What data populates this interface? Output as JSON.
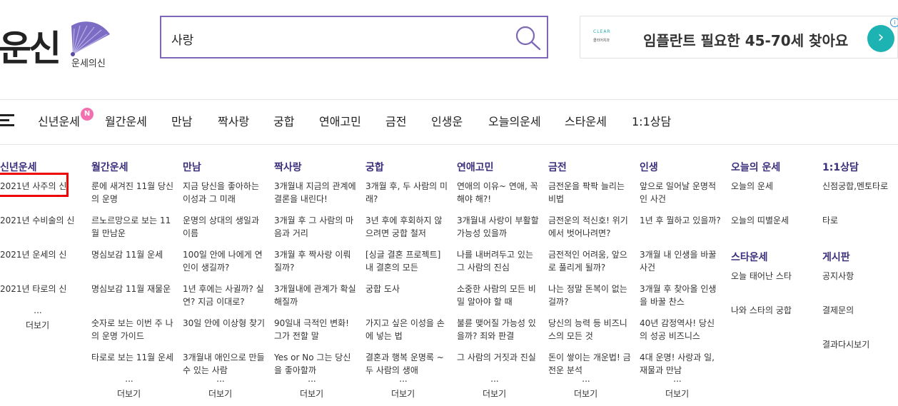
{
  "logo": {
    "main": "운신",
    "sub": "운세의신"
  },
  "search": {
    "value": "사랑"
  },
  "ad": {
    "logo_top": "CLEAR",
    "logo_bottom": "클리어치과",
    "text": "임플란트 필요한 45-70세 찾아요",
    "arrow": "›",
    "info": "i"
  },
  "nav": {
    "new_badge": "N",
    "items": [
      "신년운세",
      "월간운세",
      "만남",
      "짝사랑",
      "궁합",
      "연애고민",
      "금전",
      "인생운",
      "오늘의운세",
      "스타운세",
      "1:1상담"
    ]
  },
  "columns": [
    {
      "title": "신년운세",
      "links": [
        "2021년 사주의 신",
        "2021년 수비술의 신",
        "2021년 운세의 신",
        "2021년 타로의 신"
      ],
      "more_dots": "...",
      "more": "더보기"
    },
    {
      "title": "월간운세",
      "links": [
        "룬에 새겨진 11월 당신의 운명",
        "르노르망으로 보는 11월 만남운",
        "명심보감 11월 운세",
        "명심보감 11월 재물운",
        "숫자로 보는 이번 주 나의 운명 가이드",
        "타로로 보는 11월 운세"
      ],
      "more_dots": "...",
      "more": "더보기"
    },
    {
      "title": "만남",
      "links": [
        "지금 당신을 좋아하는 이성과 그 미래",
        "운명의 상대의 생일과 이름",
        "100일 안에 나에게 연인이 생길까?",
        "1년 후에는 사귈까? 실연? 지금 이대로?",
        "30일 안에 이상형 찾기",
        "3개월내 애인으로 만들 수 있는 사람"
      ],
      "more_dots": "...",
      "more": "더보기"
    },
    {
      "title": "짝사랑",
      "links": [
        "3개월내 지금의 관계에 결론을 내린다!",
        "3개월 후 그 사람의 마음과 거리",
        "3개월 후 짝사랑 이뤄질까?",
        "3개월내에 관계가 확실해질까",
        "90일내 극적인 변화! 그가 전할 말",
        "Yes or No 그는 당신을 좋아할까"
      ],
      "more_dots": "...",
      "more": "더보기"
    },
    {
      "title": "궁합",
      "links": [
        "3개월 후, 두 사람의 미래?",
        "3년 후에 후회하지 않으려면 궁합 철저",
        "[싱글 결혼 프로젝트] 내 결혼의 모든",
        "궁합 도사",
        "가지고 싶은 이성을 손에 넣는 법",
        "결혼과 행복 운명록 ~ 두 사람의 생애"
      ],
      "more_dots": "...",
      "more": "더보기"
    },
    {
      "title": "연애고민",
      "links": [
        "연애의 이유~ 연애, 꼭 해야 해?!",
        "3개월내 사랑이 부활할 가능성 있을까",
        "나를 내버려두고 있는 그 사람의 진심",
        "소중한 사람의 모든 비밀 알아야 할 때",
        "불륜 맺어질 가능성 있을까? 죄와 판결",
        "그 사람의 거짓과 진실"
      ],
      "more_dots": "...",
      "more": "더보기"
    },
    {
      "title": "금전",
      "links": [
        "금전운을 팍팍 늘리는 비법",
        "금전운의 적신호! 위기에서 벗어나려면?",
        "금전적인 어려움, 앞으로 풀리게 될까?",
        "나는 정말 돈복이 없는 걸까?",
        "당신의 능력 등 비즈니스의 모든 것",
        "돈이 쌓이는 개운법! 금전운 분석"
      ],
      "more_dots": "...",
      "more": "더보기"
    },
    {
      "title": "인생",
      "links": [
        "앞으로 일어날 운명적인 사건",
        "1년 후 뭘하고 있을까?",
        "3개월 내 인생을 바꿀 사건",
        "3개월 후 찾아올 인생을 바꿀 찬스",
        "40년 감정역사! 당신의 성공 비즈니스",
        "4대 운명! 사랑과 일, 재물과 만남"
      ],
      "more_dots": "...",
      "more": "더보기"
    },
    {
      "title": "오늘의 운세",
      "links": [
        "오늘의 운세",
        "오늘의 띠별운세"
      ],
      "title2": "스타운세",
      "links2": [
        "오늘 태어난 스타",
        "나와 스타의 궁합"
      ]
    },
    {
      "title": "1:1상담",
      "links": [
        "신점궁합,멘토타로",
        "타로"
      ],
      "title2": "게시판",
      "links2": [
        "공지사항",
        "결제문의",
        "결과다시보기"
      ]
    }
  ]
}
